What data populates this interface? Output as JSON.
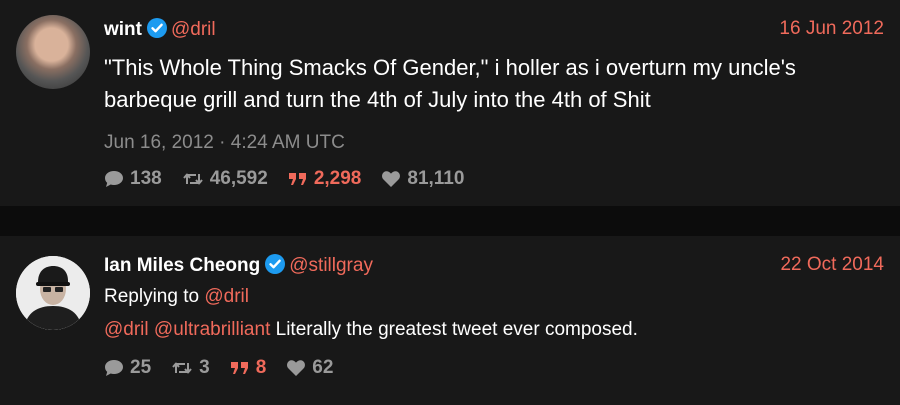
{
  "tweets": [
    {
      "name": "wint",
      "handle": "@dril",
      "date": "16 Jun 2012",
      "text": "\"This Whole Thing Smacks Of Gender,\" i holler as i overturn my uncle's barbeque grill and turn the 4th of July into the 4th of Shit",
      "timestamp": "Jun 16, 2012 · 4:24 AM UTC",
      "stats": {
        "replies": "138",
        "retweets": "46,592",
        "quotes": "2,298",
        "likes": "81,110"
      }
    },
    {
      "name": "Ian Miles Cheong",
      "handle": "@stillgray",
      "date": "22 Oct 2014",
      "replying_label": "Replying to",
      "replying_handle": "@dril",
      "mention1": "@dril",
      "mention2": "@ultrabrilliant",
      "text": "Literally the greatest tweet ever composed.",
      "stats": {
        "replies": "25",
        "retweets": "3",
        "quotes": "8",
        "likes": "62"
      }
    }
  ],
  "colors": {
    "accent": "#f06a5b",
    "verified": "#1d9bf0",
    "background": "#181818",
    "separator": "#0c0c0c"
  },
  "icons": [
    "verified-badge-icon",
    "reply-icon",
    "retweet-icon",
    "quote-icon",
    "like-icon"
  ]
}
